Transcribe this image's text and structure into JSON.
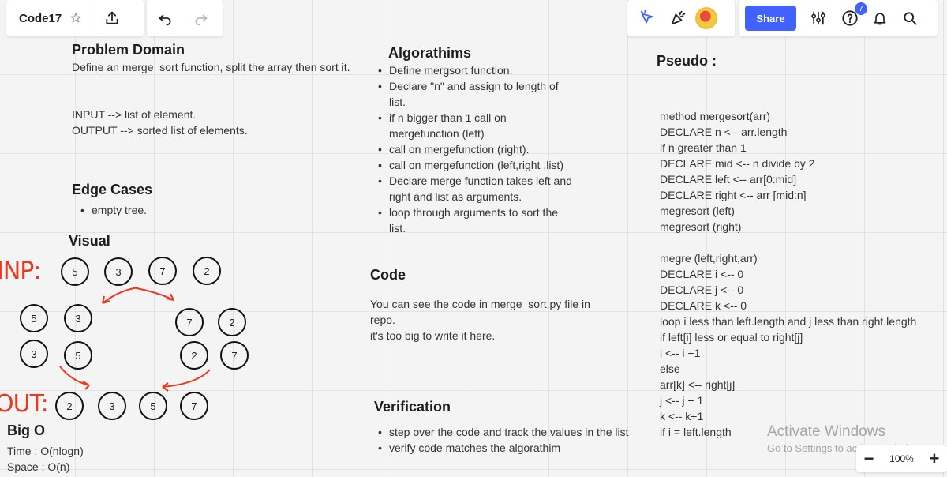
{
  "toolbar": {
    "board_title": "Code17",
    "share_label": "Share",
    "notification_count": "7",
    "zoom_level": "100%",
    "zoom_minus": "−",
    "zoom_plus": "+"
  },
  "problem_domain": {
    "title": "Problem Domain",
    "description": "Define an merge_sort function, split the array then sort it.",
    "input": "INPUT -->  list of element.",
    "output": "OUTPUT --> sorted list of elements."
  },
  "edge_cases": {
    "title": "Edge Cases",
    "items": [
      "empty tree."
    ]
  },
  "visual": {
    "title": "Visual",
    "inp_label": "INP:",
    "out_label": "OUT:",
    "row1": [
      "5",
      "3",
      "7",
      "2"
    ],
    "left_pair_top": [
      "5",
      "3"
    ],
    "right_pair_top": [
      "7",
      "2"
    ],
    "left_pair_bottom": [
      "3",
      "5"
    ],
    "right_pair_bottom": [
      "2",
      "7"
    ],
    "output_row": [
      "2",
      "3",
      "5",
      "7"
    ]
  },
  "big_o": {
    "title": "Big O",
    "time": "Time : O(nlogn)",
    "space": "Space : O(n)"
  },
  "algorithms": {
    "title": "Algorathims",
    "items": [
      "Define mergsort function.",
      "Declare \"n\" and assign to length of list.",
      "if n bigger than 1 call on mergefunction (left)",
      "call on mergefunction (right).",
      "call on mergefunction (left,right ,list)",
      "Declare merge function takes left and right and list as arguments.",
      "loop through arguments to sort the list."
    ]
  },
  "code": {
    "title": "Code",
    "lines": [
      "You can see the code in merge_sort.py file in repo.",
      "it's too big to write it here."
    ]
  },
  "verification": {
    "title": "Verification",
    "items": [
      "step over the code and track the values in the list",
      "verify code matches the algorathim"
    ]
  },
  "pseudo": {
    "title": "Pseudo :",
    "lines": [
      "method mergesort(arr)",
      "DECLARE n <-- arr.length",
      "if n greater than 1",
      "DECLARE mid <-- n divide by 2",
      "DECLARE left <-- arr[0:mid]",
      "DECLARE right <-- arr [mid:n]",
      "megresort (left)",
      "megresort (right)",
      "",
      "megre (left,right,arr)",
      "DECLARE i <-- 0",
      "DECLARE j <-- 0",
      "DECLARE k <-- 0",
      "loop i less than left.length and j less than right.length",
      "if left[i] less or equal to right[j]",
      "i <-- i +1",
      "else",
      "arr[k] <-- right[j]",
      "j <-- j + 1",
      "k <-- k+1",
      "if i = left.length"
    ]
  },
  "watermark": {
    "title": "Activate Windows",
    "subtitle": "Go to Settings to activate Windows."
  },
  "colors": {
    "accent": "#4262ff",
    "annotation": "#e8391f",
    "badge": "#4262ff"
  }
}
